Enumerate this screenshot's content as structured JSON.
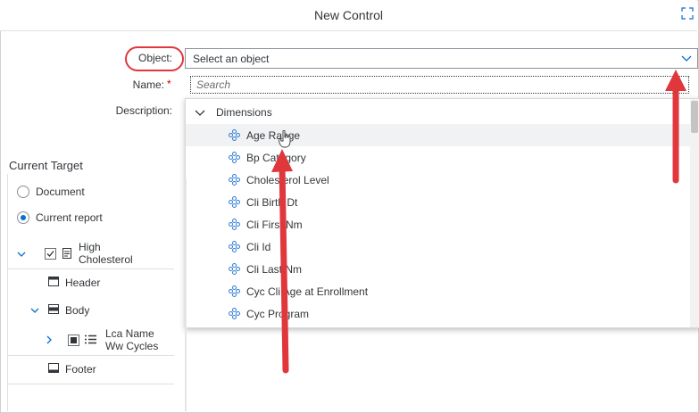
{
  "dialog": {
    "title": "New Control"
  },
  "form": {
    "object_label": "Object:",
    "object_value": "Select an object",
    "name_label": "Name:",
    "required_mark": "*",
    "description_label": "Description:"
  },
  "dropdown": {
    "search_placeholder": "Search",
    "group_label": "Dimensions",
    "items": [
      {
        "label": "Age Range"
      },
      {
        "label": "Bp Category"
      },
      {
        "label": "Cholesterol Level"
      },
      {
        "label": "Cli Birth Dt"
      },
      {
        "label": "Cli First Nm"
      },
      {
        "label": "Cli Id"
      },
      {
        "label": "Cli Last Nm"
      },
      {
        "label": "Cyc Cli Age at Enrollment"
      },
      {
        "label": "Cyc Program"
      }
    ]
  },
  "target": {
    "title": "Current Target",
    "option_document": "Document",
    "option_report": "Current report",
    "report_name_line1": "High",
    "report_name_line2": "Cholesterol",
    "header": "Header",
    "body": "Body",
    "block_line1": "Lca Name",
    "block_line2": "Ww Cycles",
    "footer": "Footer"
  },
  "colors": {
    "accent": "#0a6ed1",
    "annotation": "#e0373d",
    "dimension_icon": "#2b7cd3"
  }
}
